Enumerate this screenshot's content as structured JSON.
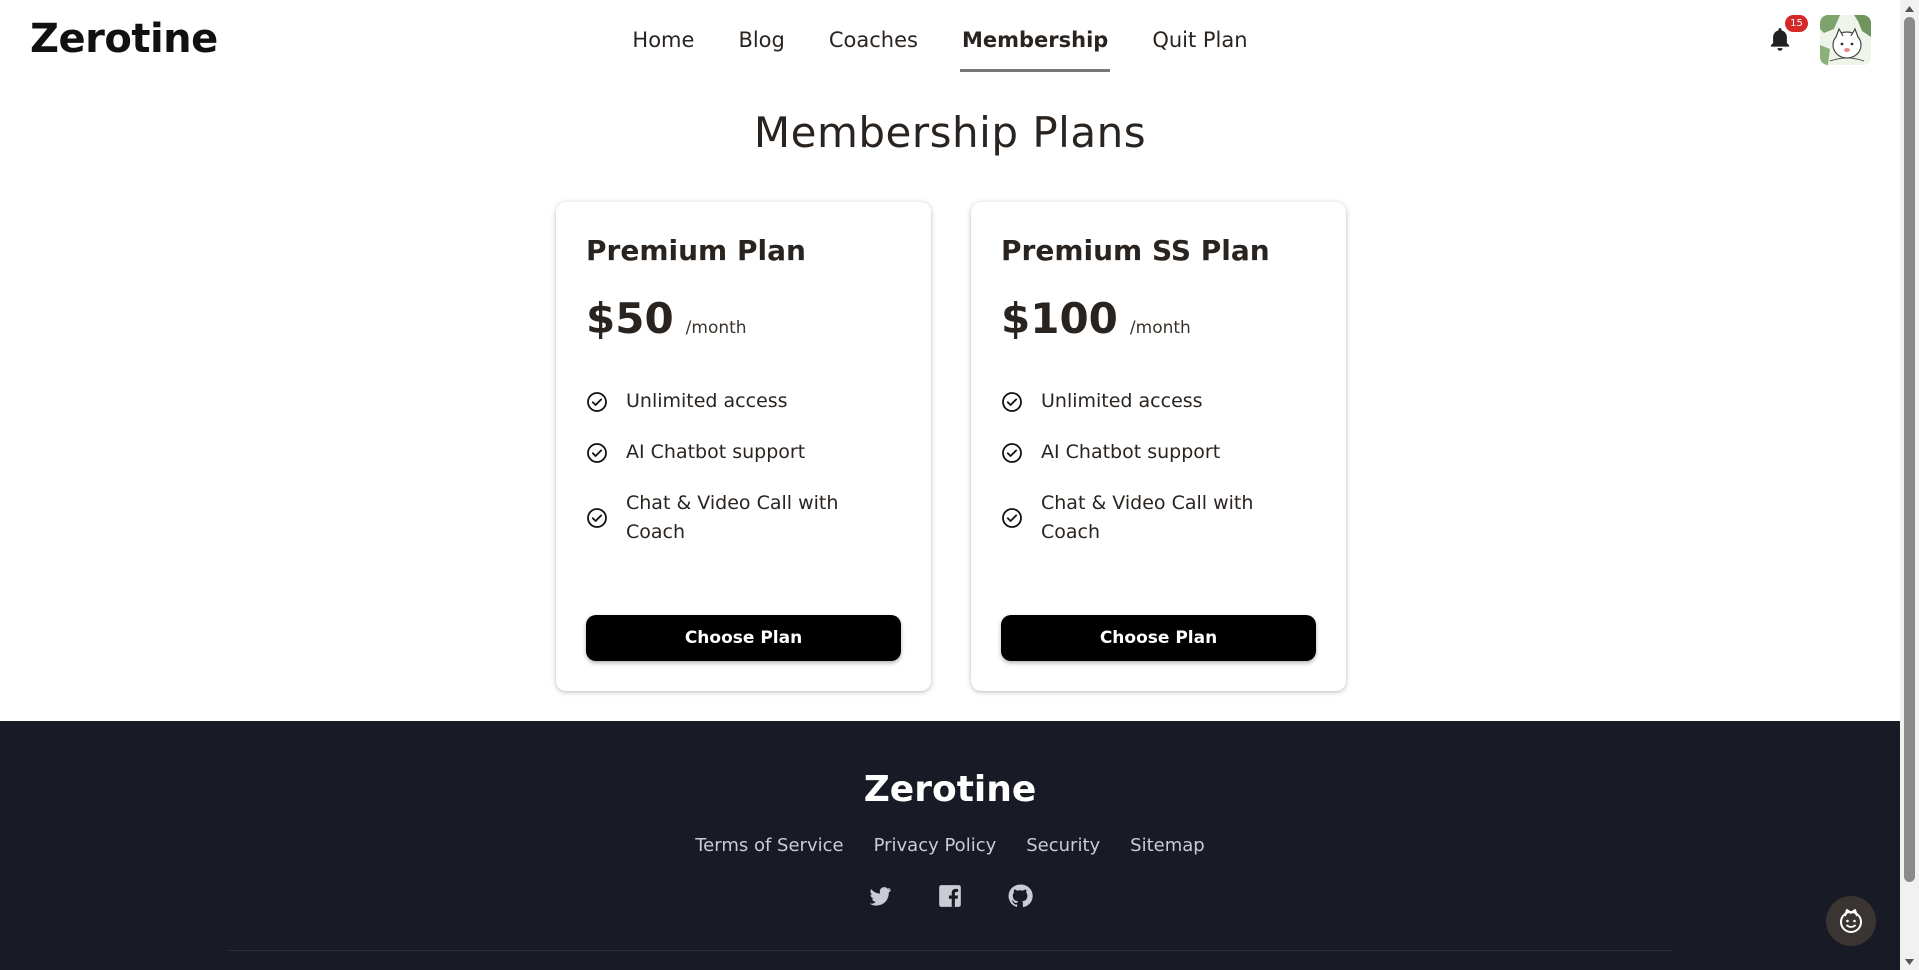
{
  "header": {
    "logo": "Zerotine",
    "nav": [
      {
        "label": "Home",
        "active": false
      },
      {
        "label": "Blog",
        "active": false
      },
      {
        "label": "Coaches",
        "active": false
      },
      {
        "label": "Membership",
        "active": true
      },
      {
        "label": "Quit Plan",
        "active": false
      }
    ],
    "notification_count": "15",
    "icons": {
      "bell": "bell-icon",
      "avatar": "user-avatar"
    }
  },
  "main": {
    "title": "Membership Plans",
    "plans": [
      {
        "name": "Premium Plan",
        "price": "$50",
        "period": "/month",
        "features": [
          "Unlimited access",
          "AI Chatbot support",
          "Chat & Video Call with Coach"
        ],
        "button": "Choose Plan"
      },
      {
        "name": "Premium SS Plan",
        "price": "$100",
        "period": "/month",
        "features": [
          "Unlimited access",
          "AI Chatbot support",
          "Chat & Video Call with Coach"
        ],
        "button": "Choose Plan"
      }
    ]
  },
  "footer": {
    "logo": "Zerotine",
    "links": [
      "Terms of Service",
      "Privacy Policy",
      "Security",
      "Sitemap"
    ],
    "socials": [
      "twitter-icon",
      "facebook-icon",
      "github-icon"
    ]
  },
  "colors": {
    "text": "#2a2420",
    "footer_bg": "#181b25",
    "button_bg": "#000000",
    "badge": "#d62828"
  }
}
